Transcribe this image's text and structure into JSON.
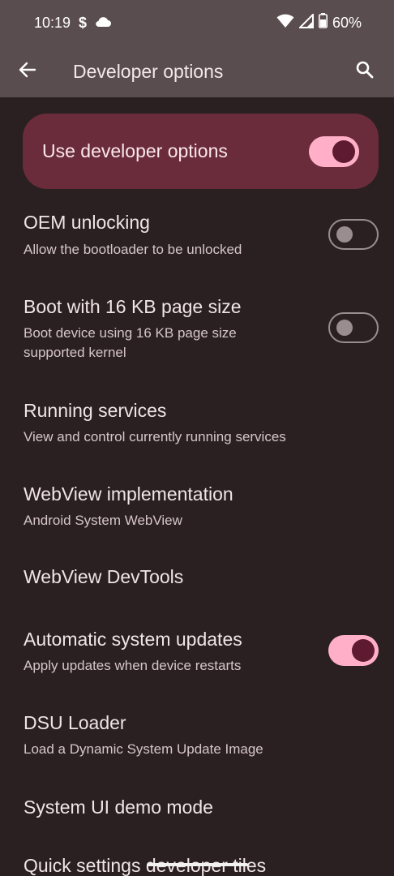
{
  "status_bar": {
    "time": "10:19",
    "extra_icon": "$",
    "battery": "60%",
    "icons": [
      "cloud-icon",
      "wifi-icon",
      "cell-signal-icon",
      "battery-icon"
    ]
  },
  "app_bar": {
    "title": "Developer options",
    "back_icon": "arrow-back-icon",
    "search_icon": "search-icon"
  },
  "master": {
    "label": "Use developer options",
    "enabled": true
  },
  "prefs": [
    {
      "title": "OEM unlocking",
      "summary": [
        "Allow the bootloader to be unlocked"
      ],
      "switch": false
    },
    {
      "title": "Boot with 16 KB page size",
      "summary": [
        "Boot device using 16 KB page size",
        "supported kernel"
      ],
      "switch": false
    },
    {
      "title": "Running services",
      "summary": [
        "View and control currently running services"
      ]
    },
    {
      "title": "WebView implementation",
      "summary": [
        "Android System WebView"
      ]
    },
    {
      "title": "WebView DevTools",
      "summary": []
    },
    {
      "title": "Automatic system updates",
      "summary": [
        "Apply updates when device restarts"
      ],
      "switch": true
    },
    {
      "title": "DSU Loader",
      "summary": [
        "Load a Dynamic System Update Image"
      ]
    },
    {
      "title": "System UI demo mode",
      "summary": []
    },
    {
      "title": "Quick settings developer tiles",
      "summary": []
    }
  ],
  "colors": {
    "app_bar_bg": "#5a4d4f",
    "background": "#2a2022",
    "master_card_bg": "#6a2c3a",
    "switch_on_track": "#ffb0c8",
    "switch_on_thumb": "#5e1a30"
  }
}
